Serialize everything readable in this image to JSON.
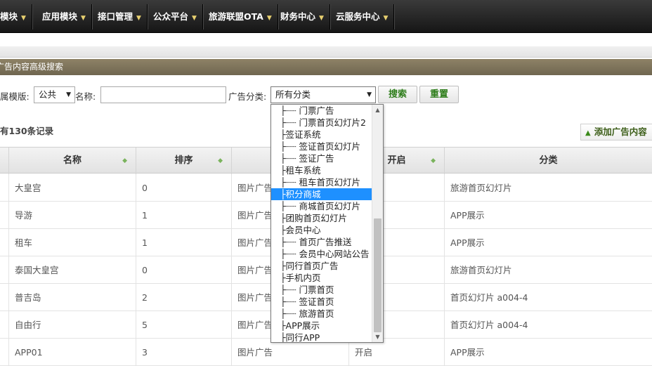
{
  "nav": {
    "items": [
      {
        "label": "模块"
      },
      {
        "label": "应用模块"
      },
      {
        "label": "接口管理"
      },
      {
        "label": "公众平台"
      },
      {
        "label": "旅游联盟OTA"
      },
      {
        "label": "财务中心"
      },
      {
        "label": "云服务中心"
      }
    ]
  },
  "section": {
    "title": "广告内容高级搜索"
  },
  "search": {
    "template_label": "属模版:",
    "template_value": "公共",
    "name_label": "名称:",
    "name_value": "",
    "category_label": "广告分类:",
    "category_value": "所有分类",
    "search_button": "搜索",
    "reset_button": "重置"
  },
  "summary": {
    "count_text": "有130条记录"
  },
  "actions": {
    "add_label": "添加广告内容"
  },
  "table": {
    "headers": [
      "名称",
      "排序",
      "",
      "开启",
      "分类"
    ],
    "rows": [
      {
        "name": "大皇宫",
        "order": "0",
        "type": "图片广告",
        "enabled": "",
        "category": "旅游首页幻灯片"
      },
      {
        "name": "导游",
        "order": "1",
        "type": "图片广告",
        "enabled": "",
        "category": "APP展示"
      },
      {
        "name": "租车",
        "order": "1",
        "type": "图片广告",
        "enabled": "",
        "category": "APP展示"
      },
      {
        "name": "泰国大皇宫",
        "order": "0",
        "type": "图片广告",
        "enabled": "",
        "category": "旅游首页幻灯片"
      },
      {
        "name": "普吉岛",
        "order": "2",
        "type": "图片广告",
        "enabled": "",
        "category": "首页幻灯片 a004-4"
      },
      {
        "name": "自由行",
        "order": "5",
        "type": "图片广告",
        "enabled": "",
        "category": "首页幻灯片 a004-4"
      },
      {
        "name": "APP01",
        "order": "3",
        "type": "图片广告",
        "enabled": "开启",
        "category": "APP展示"
      }
    ]
  },
  "dropdown": {
    "selected_index": 7,
    "options": [
      "├┈┈ 门票广告",
      "├┈┈ 门票首页幻灯片2",
      "├签证系统",
      "├┈┈ 签证首页幻灯片",
      "├┈┈ 签证广告",
      "├租车系统",
      "├┈┈ 租车首页幻灯片",
      "├积分商城",
      "├┈┈ 商城首页幻灯片",
      "├团购首页幻灯片",
      "├会员中心",
      "├┈┈ 首页广告推送",
      "├┈┈ 会员中心网站公告",
      "├同行首页广告",
      "├手机内页",
      "├┈┈ 门票首页",
      "├┈┈ 签证首页",
      "├┈┈ 旅游首页",
      "├APP展示",
      "├同行APP"
    ]
  },
  "colors": {
    "accent_green": "#2e7d1b",
    "selection_blue": "#1e90ff"
  }
}
